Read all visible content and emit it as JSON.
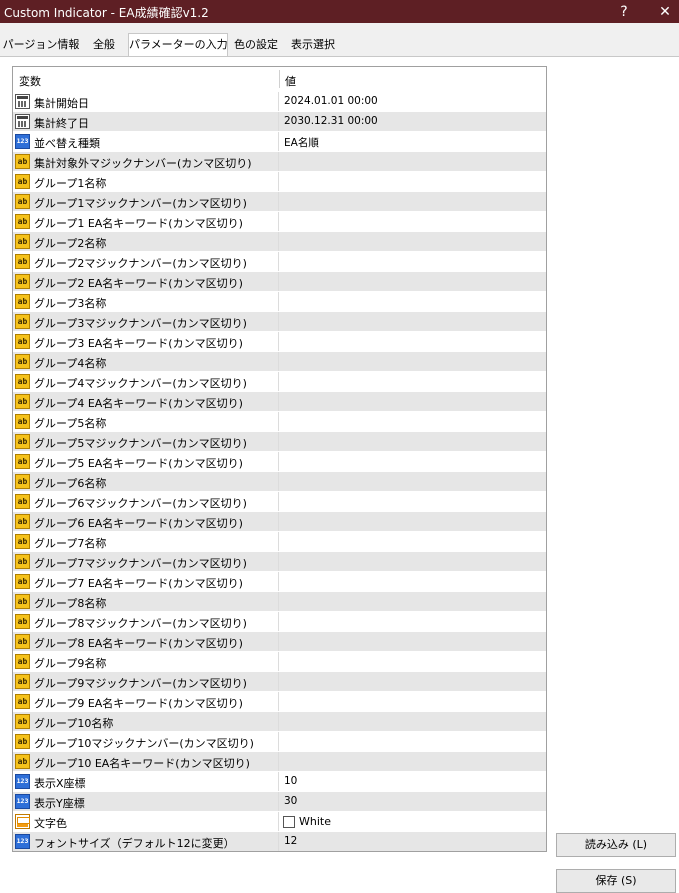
{
  "window": {
    "title": "Custom Indicator - EA成績確認v1.2",
    "help": "?",
    "close": "✕"
  },
  "tabs": [
    {
      "label": "パージョン情報"
    },
    {
      "label": "全般"
    },
    {
      "label": "パラメーターの入力"
    },
    {
      "label": "色の設定"
    },
    {
      "label": "表示選択"
    }
  ],
  "grid": {
    "col_name": "変数",
    "col_value": "値",
    "rows": [
      {
        "icon": "calendar-icon",
        "name": "集計開始日",
        "value": "2024.01.01 00:00"
      },
      {
        "icon": "calendar-icon",
        "name": "集計終了日",
        "value": "2030.12.31 00:00"
      },
      {
        "icon": "number-icon",
        "name": "並べ替え種類",
        "value": "EA名順"
      },
      {
        "icon": "text-icon",
        "name": "集計対象外マジックナンバー(カンマ区切り)",
        "value": ""
      },
      {
        "icon": "text-icon",
        "name": "グループ1名称",
        "value": ""
      },
      {
        "icon": "text-icon",
        "name": "グループ1マジックナンバー(カンマ区切り)",
        "value": ""
      },
      {
        "icon": "text-icon",
        "name": "グループ1 EA名キーワード(カンマ区切り)",
        "value": ""
      },
      {
        "icon": "text-icon",
        "name": "グループ2名称",
        "value": ""
      },
      {
        "icon": "text-icon",
        "name": "グループ2マジックナンバー(カンマ区切り)",
        "value": ""
      },
      {
        "icon": "text-icon",
        "name": "グループ2 EA名キーワード(カンマ区切り)",
        "value": ""
      },
      {
        "icon": "text-icon",
        "name": "グループ3名称",
        "value": ""
      },
      {
        "icon": "text-icon",
        "name": "グループ3マジックナンバー(カンマ区切り)",
        "value": ""
      },
      {
        "icon": "text-icon",
        "name": "グループ3 EA名キーワード(カンマ区切り)",
        "value": ""
      },
      {
        "icon": "text-icon",
        "name": "グループ4名称",
        "value": ""
      },
      {
        "icon": "text-icon",
        "name": "グループ4マジックナンバー(カンマ区切り)",
        "value": ""
      },
      {
        "icon": "text-icon",
        "name": "グループ4 EA名キーワード(カンマ区切り)",
        "value": ""
      },
      {
        "icon": "text-icon",
        "name": "グループ5名称",
        "value": ""
      },
      {
        "icon": "text-icon",
        "name": "グループ5マジックナンバー(カンマ区切り)",
        "value": ""
      },
      {
        "icon": "text-icon",
        "name": "グループ5 EA名キーワード(カンマ区切り)",
        "value": ""
      },
      {
        "icon": "text-icon",
        "name": "グループ6名称",
        "value": ""
      },
      {
        "icon": "text-icon",
        "name": "グループ6マジックナンバー(カンマ区切り)",
        "value": ""
      },
      {
        "icon": "text-icon",
        "name": "グループ6 EA名キーワード(カンマ区切り)",
        "value": ""
      },
      {
        "icon": "text-icon",
        "name": "グループ7名称",
        "value": ""
      },
      {
        "icon": "text-icon",
        "name": "グループ7マジックナンバー(カンマ区切り)",
        "value": ""
      },
      {
        "icon": "text-icon",
        "name": "グループ7 EA名キーワード(カンマ区切り)",
        "value": ""
      },
      {
        "icon": "text-icon",
        "name": "グループ8名称",
        "value": ""
      },
      {
        "icon": "text-icon",
        "name": "グループ8マジックナンバー(カンマ区切り)",
        "value": ""
      },
      {
        "icon": "text-icon",
        "name": "グループ8 EA名キーワード(カンマ区切り)",
        "value": ""
      },
      {
        "icon": "text-icon",
        "name": "グループ9名称",
        "value": ""
      },
      {
        "icon": "text-icon",
        "name": "グループ9マジックナンバー(カンマ区切り)",
        "value": ""
      },
      {
        "icon": "text-icon",
        "name": "グループ9 EA名キーワード(カンマ区切り)",
        "value": ""
      },
      {
        "icon": "text-icon",
        "name": "グループ10名称",
        "value": ""
      },
      {
        "icon": "text-icon",
        "name": "グループ10マジックナンバー(カンマ区切り)",
        "value": ""
      },
      {
        "icon": "text-icon",
        "name": "グループ10 EA名キーワード(カンマ区切り)",
        "value": ""
      },
      {
        "icon": "number-icon",
        "name": "表示X座標",
        "value": "10"
      },
      {
        "icon": "number-icon",
        "name": "表示Y座標",
        "value": "30"
      },
      {
        "icon": "color-icon",
        "name": "文字色",
        "value": "White",
        "swatch": "#ffffff"
      },
      {
        "icon": "number-icon",
        "name": "フォントサイズ（デフォルト12に変更）",
        "value": "12"
      }
    ]
  },
  "buttons": {
    "load": "読み込み (L)",
    "save": "保存 (S)"
  }
}
